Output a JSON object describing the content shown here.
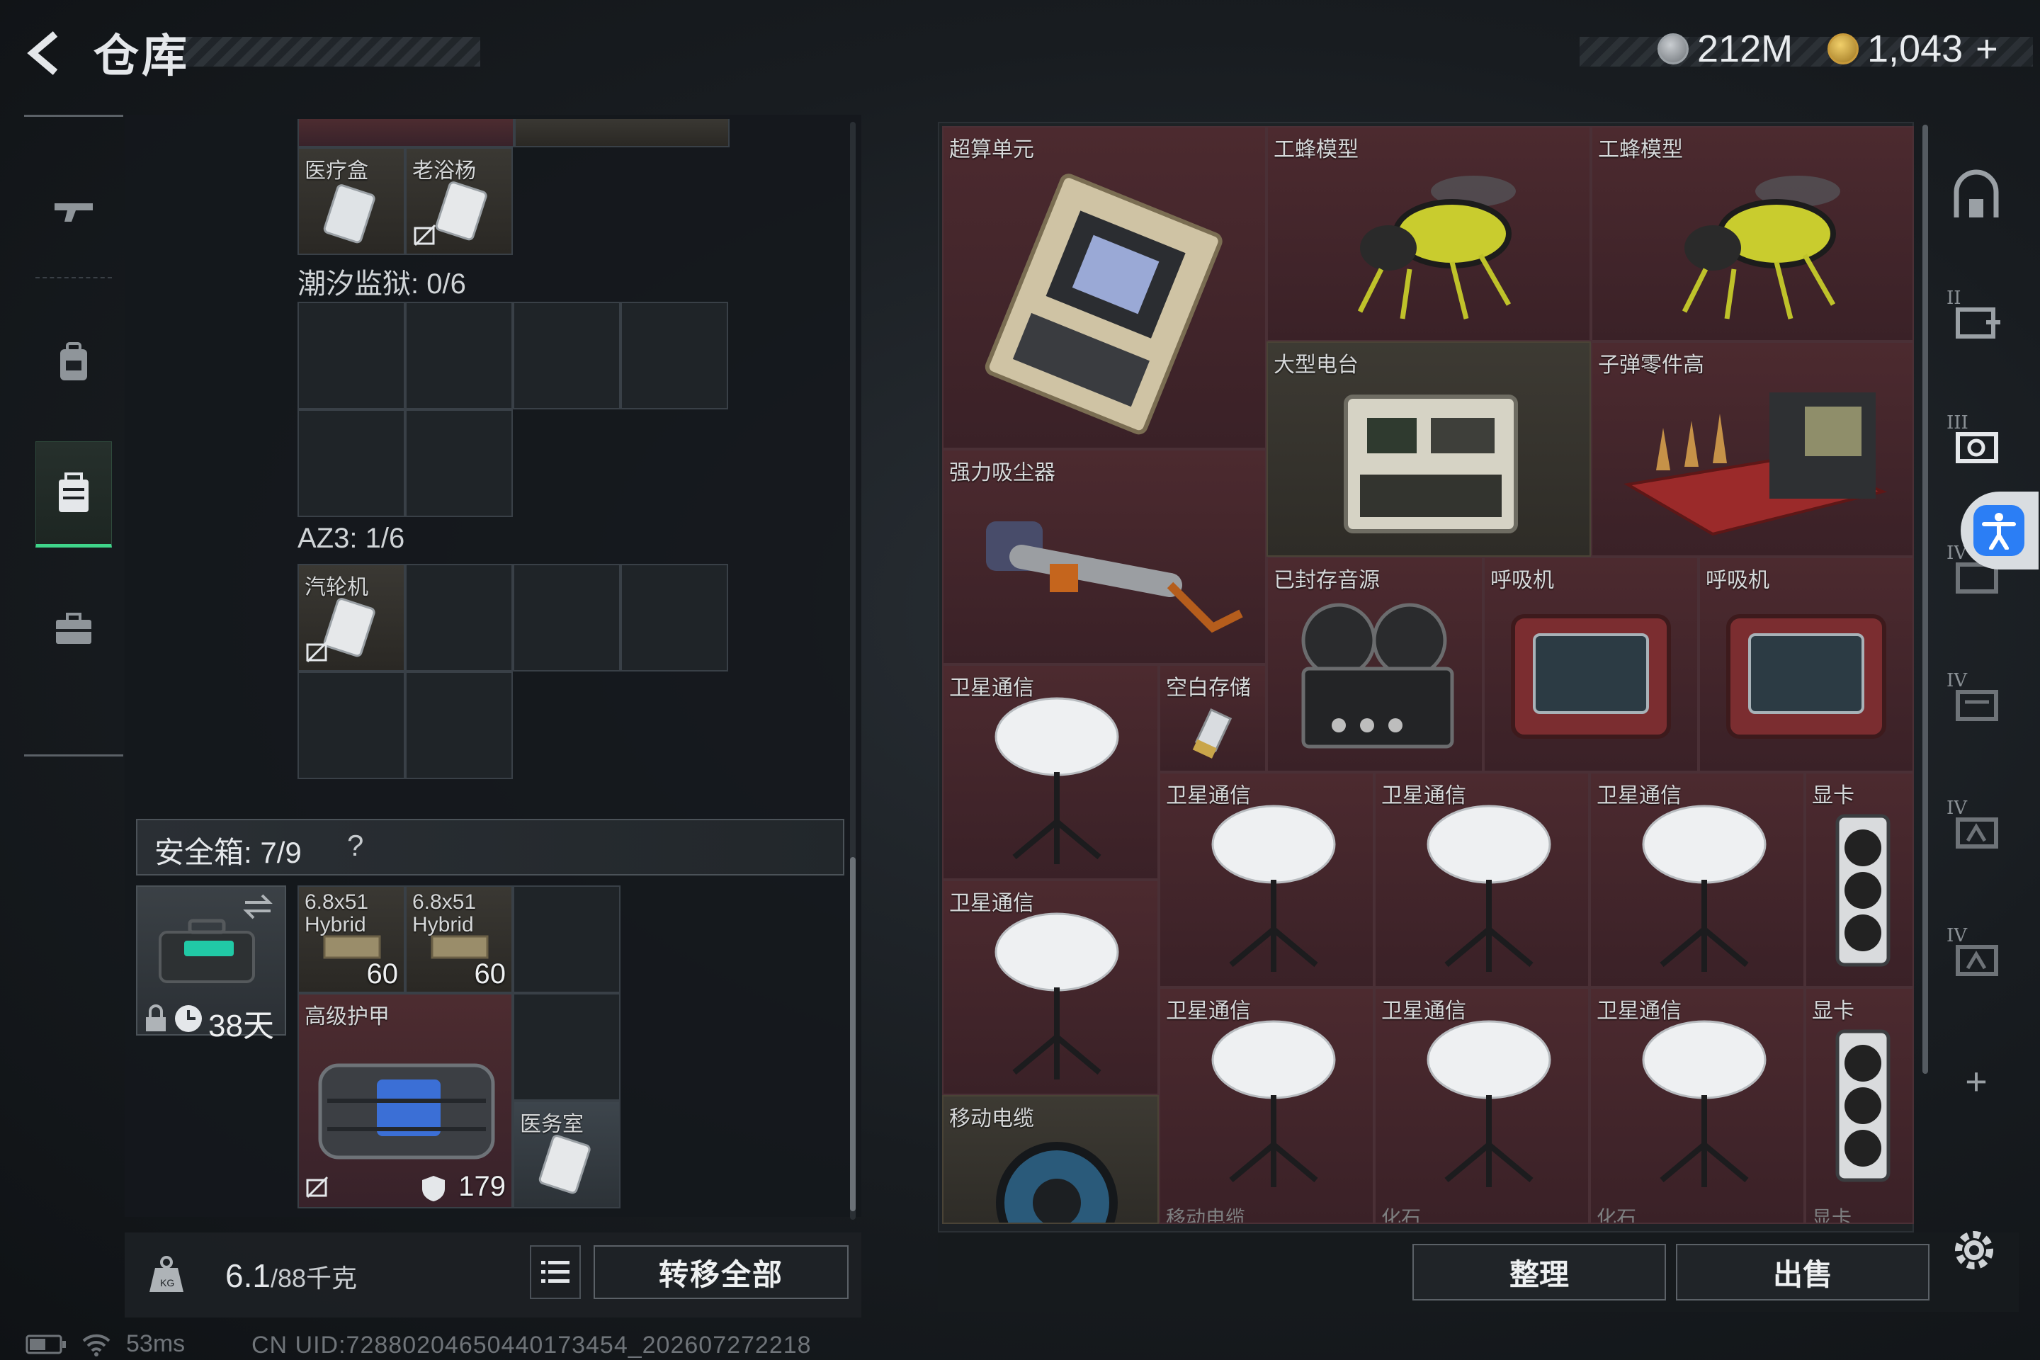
{
  "header": {
    "title": "仓库",
    "currency_a": "212M",
    "currency_b": "1,043",
    "currency_b_suffix": "+"
  },
  "colors": {
    "accent_green": "#3fd58a",
    "item_red": "#4c2a2f",
    "item_gold": "#3d3a33",
    "accessibility_blue": "#2b7ef5"
  },
  "left_rail": {
    "icons": [
      "gun-icon",
      "backpack-icon",
      "case-icon",
      "toolbox-icon"
    ],
    "active_index": 2
  },
  "stash": {
    "top_items": [
      {
        "label": "医疗盒"
      },
      {
        "label": "老浴杨"
      }
    ],
    "prison_section": "潮汐监狱: 0/6",
    "az3_section": "AZ3: 1/6",
    "az3_items": [
      {
        "label": "汽轮机"
      }
    ],
    "safebox": {
      "label": "安全箱: 7/9",
      "help": "?",
      "time": "38天"
    },
    "safe_items": [
      {
        "label": "6.8x51 Hybrid",
        "count": "60"
      },
      {
        "label": "6.8x51 Hybrid",
        "count": "60"
      },
      {
        "label": "高级护甲",
        "durability": "179"
      },
      {
        "label": "医务室"
      }
    ]
  },
  "weight": {
    "value": "6.1",
    "max": "/88千克"
  },
  "buttons": {
    "transfer_all": "转移全部",
    "sort": "整理",
    "sell": "出售"
  },
  "warehouse_items": [
    {
      "label": "超算单元"
    },
    {
      "label": "工蜂模型"
    },
    {
      "label": "工蜂模型"
    },
    {
      "label": "大型电台"
    },
    {
      "label": "子弹零件高"
    },
    {
      "label": "强力吸尘器"
    },
    {
      "label": "已封存音源"
    },
    {
      "label": "呼吸机"
    },
    {
      "label": "呼吸机"
    },
    {
      "label": "卫星通信"
    },
    {
      "label": "空白存储"
    },
    {
      "label": "卫星通信"
    },
    {
      "label": "卫星通信"
    },
    {
      "label": "卫星通信"
    },
    {
      "label": "显卡"
    },
    {
      "label": "卫星通信"
    },
    {
      "label": "卫星通信"
    },
    {
      "label": "卫星通信"
    },
    {
      "label": "卫星通信"
    },
    {
      "label": "显卡"
    },
    {
      "label": "移动电缆"
    }
  ],
  "warehouse_ghost_labels": [
    "移动电缆",
    "化石",
    "化石",
    "显卡"
  ],
  "right_rail": {
    "icons": [
      "home-icon",
      "add-tab-icon",
      "tab-3-icon",
      "tab-4-icon",
      "tab-5-icon",
      "tab-6-icon",
      "tab-7-icon"
    ],
    "romans": [
      "II",
      "III",
      "IV",
      "IV",
      "IV",
      "IV"
    ],
    "add": "+"
  },
  "status": {
    "ping": "53ms",
    "uid": "CN UID:72880204650440173454_202607272218"
  }
}
